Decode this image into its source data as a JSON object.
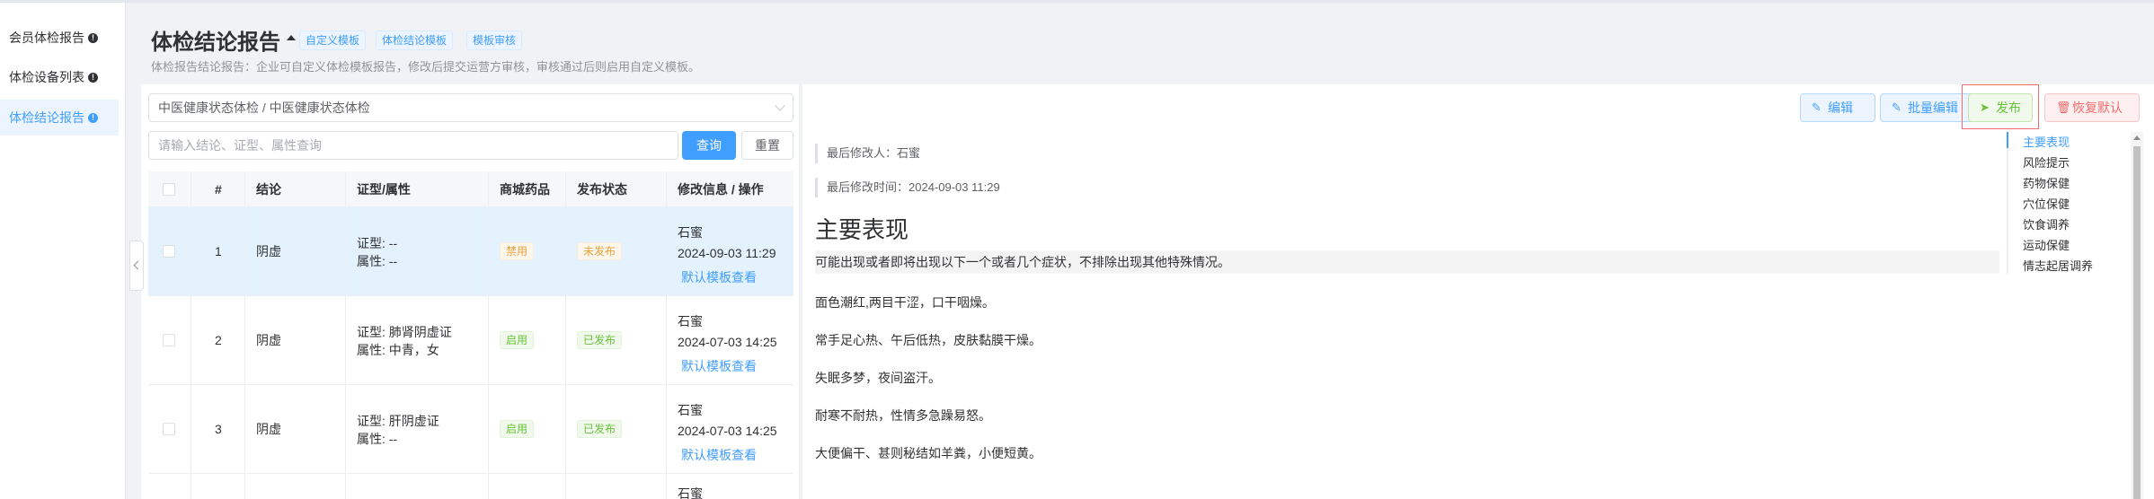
{
  "sidebar": {
    "items": [
      {
        "label": "会员体检报告",
        "active": false
      },
      {
        "label": "体检设备列表",
        "active": false
      },
      {
        "label": "体检结论报告",
        "active": true
      }
    ]
  },
  "header": {
    "title": "体检结论报告",
    "tags": [
      "自定义模板",
      "体检结论模板",
      "模板审核"
    ],
    "subtitle": "体检报告结论报告：企业可自定义体检模板报告，修改后提交运营方审核，审核通过后则启用自定义模板。"
  },
  "left": {
    "cascader_value": "中医健康状态体检 / 中医健康状态体检",
    "search_placeholder": "请输入结论、证型、属性查询",
    "search_label": "查询",
    "reset_label": "重置",
    "columns": [
      "#",
      "结论",
      "证型/属性",
      "商城药品",
      "发布状态",
      "修改信息 / 操作"
    ],
    "rows": [
      {
        "index": "1",
        "conclusion": "阴虚",
        "syndrome": "证型: --",
        "attribute": "属性: --",
        "drug": "禁用",
        "drug_status": "warn",
        "publish": "未发布",
        "publish_status": "warn",
        "modifier": "石蜜",
        "modified": "2024-09-03 11:29",
        "action": "默认模板查看",
        "selected": true
      },
      {
        "index": "2",
        "conclusion": "阴虚",
        "syndrome": "证型: 肺肾阴虚证",
        "attribute": "属性: 中青，女",
        "drug": "启用",
        "drug_status": "ok",
        "publish": "已发布",
        "publish_status": "ok",
        "modifier": "石蜜",
        "modified": "2024-07-03 14:25",
        "action": "默认模板查看",
        "selected": false
      },
      {
        "index": "3",
        "conclusion": "阴虚",
        "syndrome": "证型: 肝阴虚证",
        "attribute": "属性: --",
        "drug": "启用",
        "drug_status": "ok",
        "publish": "已发布",
        "publish_status": "ok",
        "modifier": "石蜜",
        "modified": "2024-07-03 14:25",
        "action": "默认模板查看",
        "selected": false
      },
      {
        "index": "",
        "conclusion": "",
        "syndrome": "",
        "attribute": "",
        "drug": "",
        "drug_status": "",
        "publish": "",
        "publish_status": "",
        "modifier": "石蜜",
        "modified": "",
        "action": "",
        "selected": false
      }
    ]
  },
  "right": {
    "buttons": {
      "edit": "编辑",
      "batch_edit": "批量编辑",
      "publish": "发布",
      "restore": "恢复默认"
    },
    "last_modifier": "最后修改人：石蜜",
    "last_modified": "最后修改时间：2024-09-03 11:29",
    "section_title": "主要表现",
    "intro": "可能出现或者即将出现以下一个或者几个症状，不排除出现其他特殊情况。",
    "paragraphs": [
      "面色潮红,两目干涩，口干咽燥。",
      "常手足心热、午后低热，皮肤黏膜干燥。",
      "失眠多梦，夜间盗汗。",
      "耐寒不耐热，性情多急躁易怒。",
      "大便偏干、甚则秘结如羊粪，小便短黄。"
    ],
    "toc": [
      "主要表现",
      "风险提示",
      "药物保健",
      "穴位保健",
      "饮食调养",
      "运动保健",
      "情志起居调养"
    ],
    "toc_active": 0
  },
  "colors": {
    "primary": "#409eff",
    "success": "#67c23a",
    "warning": "#e6a23c",
    "danger": "#f56c6c",
    "selected_row": "#e3f2fd"
  }
}
